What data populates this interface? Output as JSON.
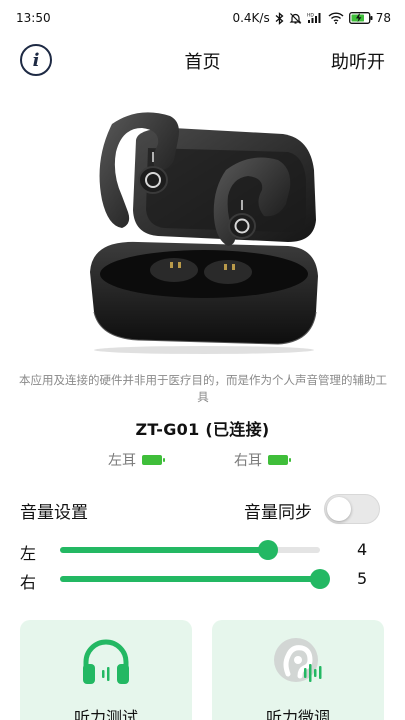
{
  "status_bar": {
    "time": "13:50",
    "network_speed": "0.4K/s",
    "battery_percent": "78",
    "icons": [
      "bluetooth-icon",
      "mute-icon",
      "hd-signal-icon",
      "wifi-icon",
      "battery-charging-icon"
    ]
  },
  "header": {
    "info_icon_glyph": "i",
    "title": "首页",
    "right_action": "助听开"
  },
  "disclaimer": "本应用及连接的硬件并非用于医疗目的，而是作为个人声音管理的辅助工具",
  "device": {
    "name": "ZT-G01 (已连接)",
    "left_ear": {
      "label": "左耳",
      "battery_level": 1.0
    },
    "right_ear": {
      "label": "右耳",
      "battery_level": 1.0
    }
  },
  "volume": {
    "title": "音量设置",
    "sync_label": "音量同步",
    "sync_enabled": false,
    "max": 5,
    "left": {
      "label": "左",
      "value": 4
    },
    "right": {
      "label": "右",
      "value": 5
    }
  },
  "cards": [
    {
      "label": "听力测试",
      "icon": "headphones-icon"
    },
    {
      "label": "听力微调",
      "icon": "ear-adjust-icon"
    }
  ],
  "colors": {
    "accent": "#23b863",
    "battery_green": "#3fbe3a",
    "card_bg": "#e6f6ec",
    "muted_text": "#8a8a8a"
  }
}
